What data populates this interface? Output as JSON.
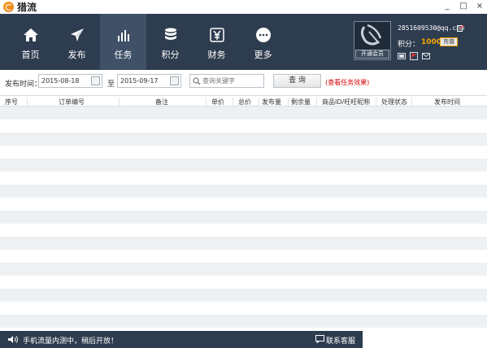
{
  "window": {
    "title": "猎流",
    "controls": [
      "_",
      "□",
      "×"
    ]
  },
  "nav": {
    "items": [
      {
        "label": "首页",
        "icon": "home-icon"
      },
      {
        "label": "发布",
        "icon": "paper-plane-icon"
      },
      {
        "label": "任务",
        "icon": "bar-chart-icon",
        "active": true
      },
      {
        "label": "积分",
        "icon": "coins-icon"
      },
      {
        "label": "财务",
        "icon": "yen-icon"
      },
      {
        "label": "更多",
        "icon": "more-dots-icon"
      }
    ]
  },
  "user": {
    "avatar_button": "开通会员",
    "email": "2851609530@qq.com",
    "points_label": "积分：",
    "points_value": "1000",
    "recharge_label": "充值"
  },
  "filter": {
    "publish_time_label": "发布时间：",
    "date_from": "2015-08-18",
    "to_label": "至",
    "date_to": "2015-09-17",
    "search_placeholder": "查询关键字",
    "query_button": "查 询",
    "effect_link": "(查看任务效果)"
  },
  "table": {
    "columns": [
      "序号",
      "订单编号",
      "备注",
      "单价",
      "总价",
      "发布量",
      "剩余量",
      "商品ID/旺旺昵称",
      "处理状态",
      "发布时间"
    ],
    "rows": []
  },
  "statusbar": {
    "message": "手机流量内测中，稍后开放！",
    "support_label": "联系客服"
  },
  "colors": {
    "nav_bg": "#2e3c4f",
    "nav_active": "#3f5067",
    "accent": "#f7a900",
    "link_red": "#d40000",
    "row_stripe": "#eef1f4"
  }
}
